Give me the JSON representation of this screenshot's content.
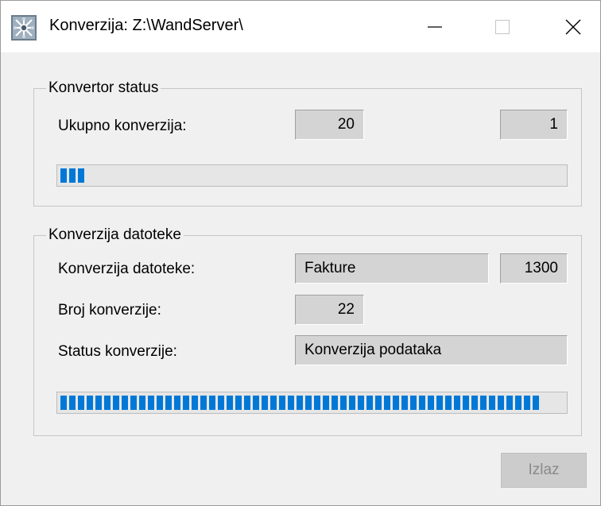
{
  "window": {
    "title": "Konverzija: Z:\\WandServer\\",
    "app_icon": "snowflake-app-icon",
    "controls": [
      "minimize-icon",
      "maximize-icon",
      "close-icon"
    ]
  },
  "converter_status": {
    "legend": "Konvertor status",
    "total_label": "Ukupno konverzija:",
    "total_value": "20",
    "current_value": "1",
    "progress_fraction": 0.05
  },
  "file_conversion": {
    "legend": "Konverzija datoteke",
    "file_label": "Konverzija datoteke:",
    "file_name": "Fakture",
    "file_code": "1300",
    "count_label": "Broj konverzije:",
    "count_value": "22",
    "status_label": "Status konverzije:",
    "status_value": "Konverzija podataka",
    "progress_fraction": 0.95
  },
  "footer": {
    "exit_label": "Izlaz"
  },
  "colors": {
    "progress": "#0078d7",
    "field_background": "#d4d4d4",
    "window_background": "#f0f0f0"
  }
}
